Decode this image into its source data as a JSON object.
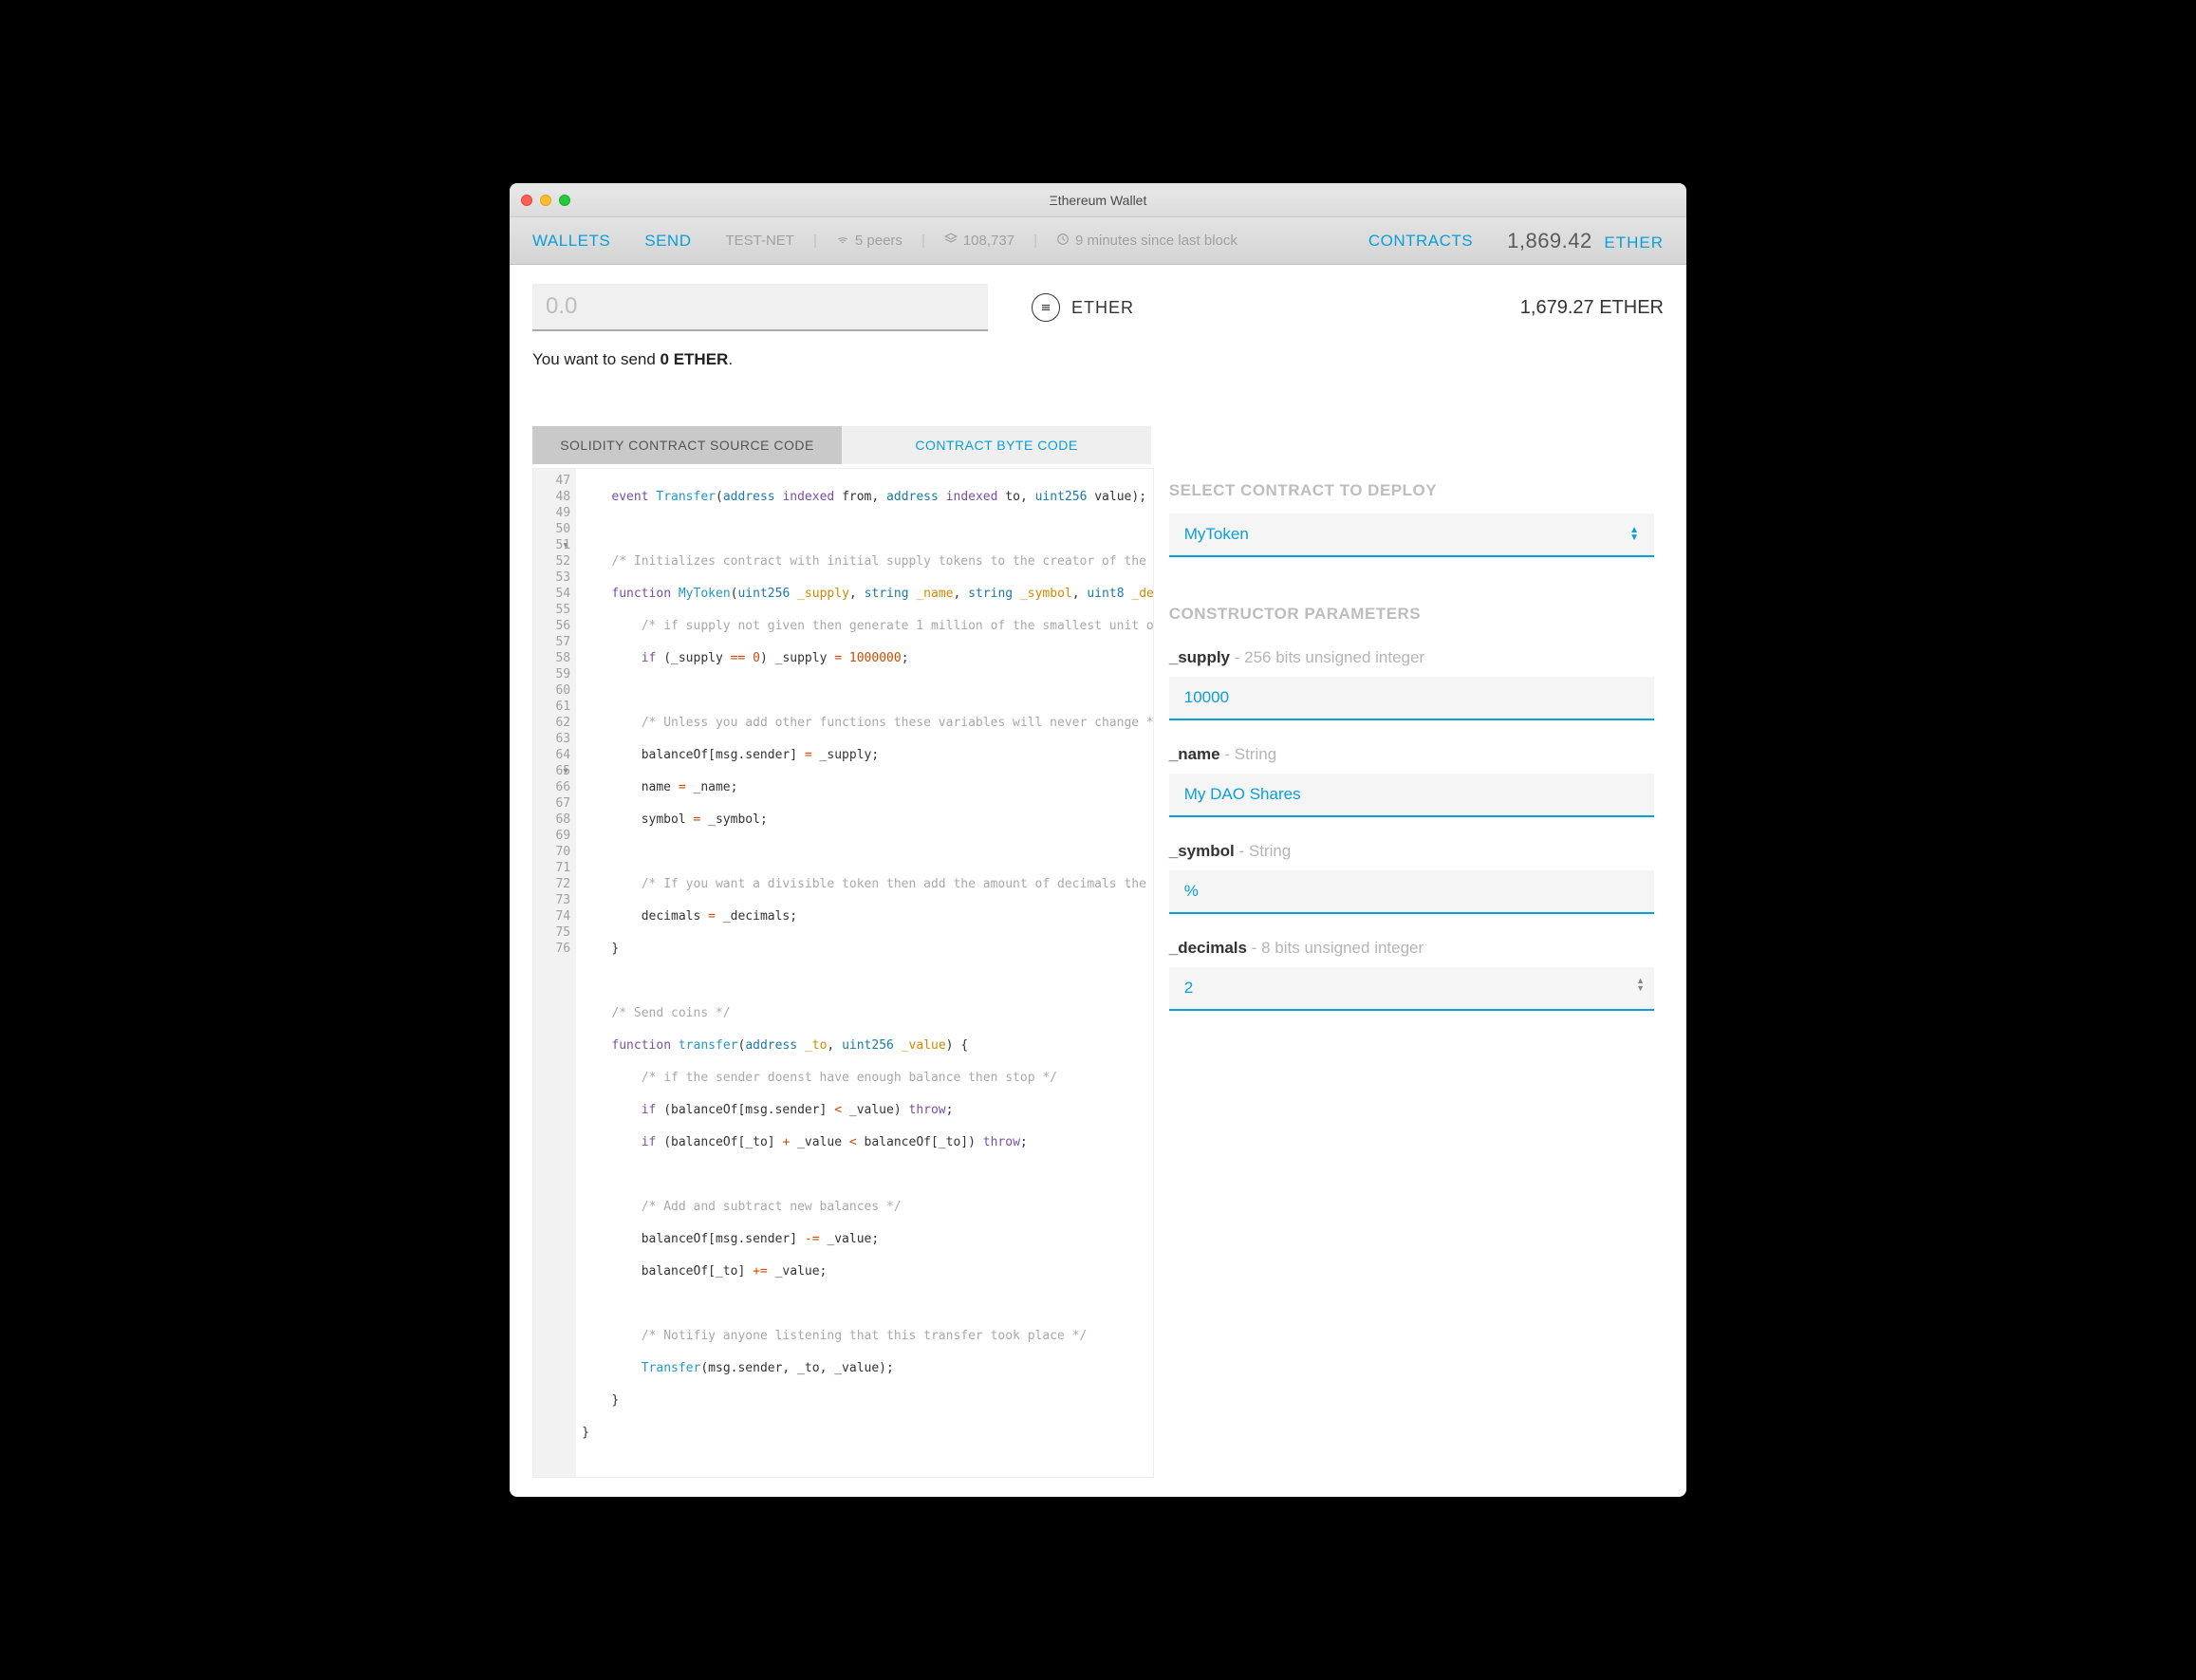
{
  "window": {
    "title": "Ξthereum Wallet"
  },
  "nav": {
    "wallets": "WALLETS",
    "send": "SEND",
    "testnet": "TEST-NET",
    "peers": "5 peers",
    "blocks": "108,737",
    "sync": "9 minutes since last block",
    "contracts": "CONTRACTS",
    "balance_num": "1,869.42",
    "balance_unit": "ETHER"
  },
  "send": {
    "amount_placeholder": "0.0",
    "currency": "ETHER",
    "account_balance": "1,679.27 ETHER",
    "summary_pre": "You want to send ",
    "summary_val": "0 ETHER",
    "summary_post": "."
  },
  "tabs": {
    "source": "SOLIDITY CONTRACT SOURCE CODE",
    "byte": "CONTRACT BYTE CODE"
  },
  "deploy": {
    "select_title": "SELECT CONTRACT TO DEPLOY",
    "selected": "MyToken",
    "params_title": "CONSTRUCTOR PARAMETERS",
    "p_supply_label": "_supply",
    "p_supply_hint": " - 256 bits unsigned integer",
    "p_supply_val": "10000",
    "p_name_label": "_name",
    "p_name_hint": " - String",
    "p_name_val": "My DAO Shares",
    "p_symbol_label": "_symbol",
    "p_symbol_hint": " - String",
    "p_symbol_val": "%",
    "p_decimals_label": "_decimals",
    "p_decimals_hint": " - 8 bits unsigned integer",
    "p_decimals_val": "2"
  },
  "code": {
    "start": 47,
    "end": 76,
    "fold_lines": [
      50,
      64
    ]
  }
}
